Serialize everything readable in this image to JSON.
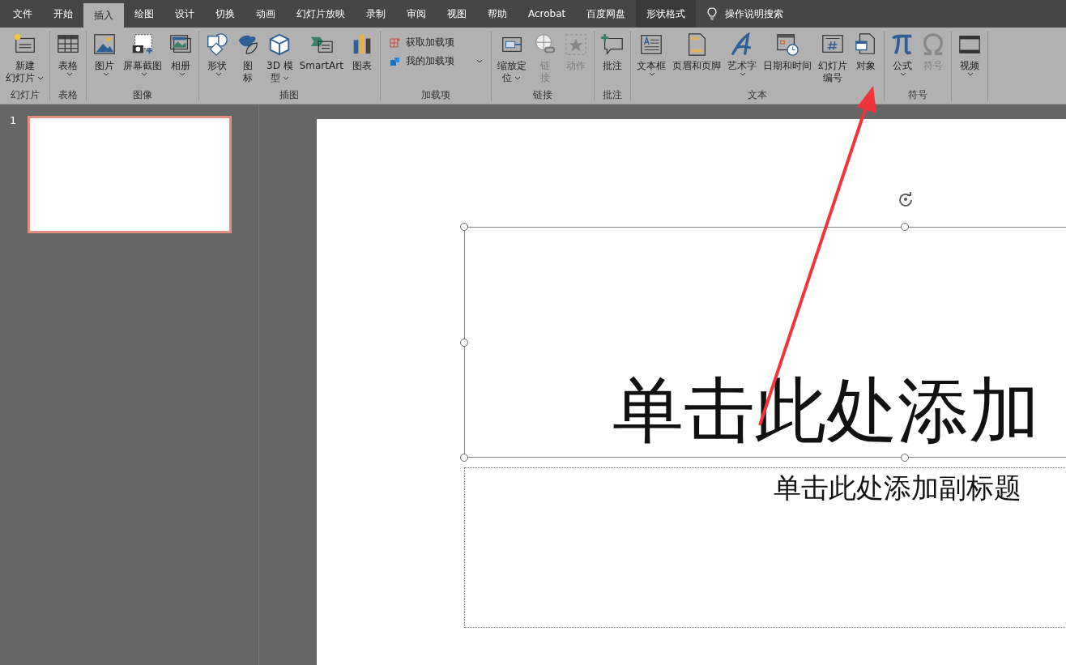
{
  "tabs": [
    {
      "label": "文件",
      "selected": false,
      "kind": "normal"
    },
    {
      "label": "开始",
      "selected": false,
      "kind": "normal"
    },
    {
      "label": "插入",
      "selected": true,
      "kind": "normal"
    },
    {
      "label": "绘图",
      "selected": false,
      "kind": "normal"
    },
    {
      "label": "设计",
      "selected": false,
      "kind": "normal"
    },
    {
      "label": "切换",
      "selected": false,
      "kind": "normal"
    },
    {
      "label": "动画",
      "selected": false,
      "kind": "normal"
    },
    {
      "label": "幻灯片放映",
      "selected": false,
      "kind": "normal"
    },
    {
      "label": "录制",
      "selected": false,
      "kind": "normal"
    },
    {
      "label": "审阅",
      "selected": false,
      "kind": "normal"
    },
    {
      "label": "视图",
      "selected": false,
      "kind": "normal"
    },
    {
      "label": "帮助",
      "selected": false,
      "kind": "normal"
    },
    {
      "label": "Acrobat",
      "selected": false,
      "kind": "normal"
    },
    {
      "label": "百度网盘",
      "selected": false,
      "kind": "normal"
    },
    {
      "label": "形状格式",
      "selected": false,
      "kind": "contextual"
    }
  ],
  "search": {
    "label": "操作说明搜索"
  },
  "ribbon": {
    "groups": [
      {
        "label": "幻灯片",
        "items": [
          {
            "lines": [
              "新建",
              "幻灯片"
            ],
            "dropdown": true,
            "disabled": false
          }
        ]
      },
      {
        "label": "表格",
        "items": [
          {
            "lines": [
              "表格"
            ],
            "dropdown": true,
            "disabled": false
          }
        ]
      },
      {
        "label": "图像",
        "items": [
          {
            "lines": [
              "图片"
            ],
            "dropdown": true,
            "disabled": false
          },
          {
            "lines": [
              "屏幕截图"
            ],
            "dropdown": true,
            "disabled": false
          },
          {
            "lines": [
              "相册"
            ],
            "dropdown": true,
            "disabled": false
          }
        ]
      },
      {
        "label": "插图",
        "items": [
          {
            "lines": [
              "形状"
            ],
            "dropdown": true,
            "disabled": false
          },
          {
            "lines": [
              "图",
              "标"
            ],
            "dropdown": false,
            "disabled": false
          },
          {
            "lines": [
              "3D 模",
              "型"
            ],
            "dropdown": true,
            "disabled": false
          },
          {
            "lines": [
              "SmartArt"
            ],
            "dropdown": false,
            "disabled": false
          },
          {
            "lines": [
              "图表"
            ],
            "dropdown": false,
            "disabled": false
          }
        ]
      },
      {
        "label": "加载项",
        "items": [
          {
            "kind": "small",
            "lines": [
              "获取加载项"
            ],
            "dropdown": false,
            "disabled": false
          },
          {
            "kind": "small",
            "lines": [
              "我的加载项"
            ],
            "dropdown": true,
            "disabled": false
          }
        ]
      },
      {
        "label": "链接",
        "items": [
          {
            "lines": [
              "缩放定",
              "位"
            ],
            "dropdown": true,
            "disabled": false
          },
          {
            "lines": [
              "链",
              "接"
            ],
            "dropdown": false,
            "disabled": true
          },
          {
            "lines": [
              "动作"
            ],
            "dropdown": false,
            "disabled": true
          }
        ]
      },
      {
        "label": "批注",
        "items": [
          {
            "lines": [
              "批注"
            ],
            "dropdown": false,
            "disabled": false
          }
        ]
      },
      {
        "label": "文本",
        "items": [
          {
            "lines": [
              "文本框"
            ],
            "dropdown": true,
            "disabled": false
          },
          {
            "lines": [
              "页眉和页脚"
            ],
            "dropdown": false,
            "disabled": false
          },
          {
            "lines": [
              "艺术字"
            ],
            "dropdown": true,
            "disabled": false
          },
          {
            "lines": [
              "日期和时间"
            ],
            "dropdown": false,
            "disabled": false
          },
          {
            "lines": [
              "幻灯片",
              "编号"
            ],
            "dropdown": false,
            "disabled": false
          },
          {
            "lines": [
              "对象"
            ],
            "dropdown": false,
            "disabled": false
          }
        ]
      },
      {
        "label": "符号",
        "items": [
          {
            "lines": [
              "公式"
            ],
            "dropdown": true,
            "disabled": false
          },
          {
            "lines": [
              "符号"
            ],
            "dropdown": false,
            "disabled": true
          }
        ]
      },
      {
        "items": [
          {
            "lines": [
              "视频"
            ],
            "dropdown": true,
            "disabled": false
          }
        ]
      }
    ]
  },
  "thumbnails": [
    {
      "number": "1",
      "selected": true
    }
  ],
  "slide": {
    "title": "单击此处添加",
    "subtitle": "单击此处添加副标题"
  }
}
